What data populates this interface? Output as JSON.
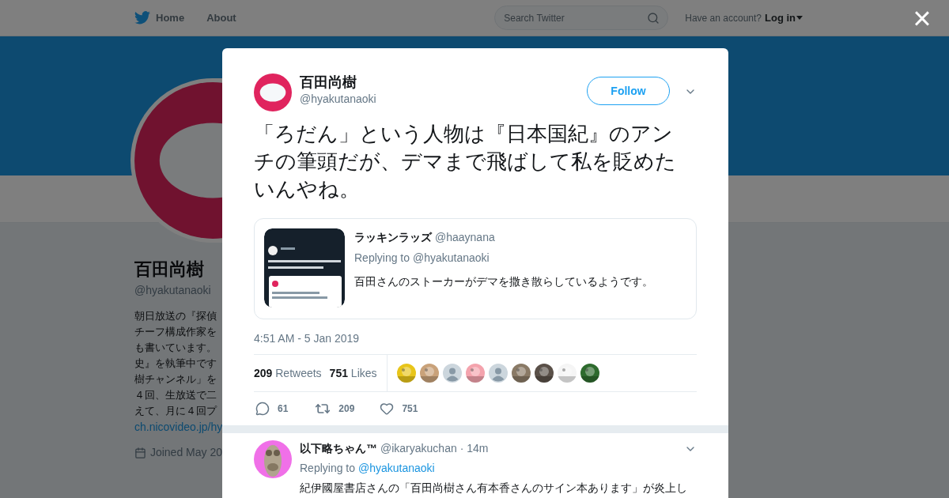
{
  "nav": {
    "home": "Home",
    "about": "About",
    "search_placeholder": "Search Twitter",
    "account_prompt": "Have an account?",
    "login": "Log in"
  },
  "profile": {
    "name": "百田尚樹",
    "handle": "@hyakutanaoki",
    "bio_lines": [
      "朝日放送の『探偵",
      "チーフ構成作家を",
      "も書いています。",
      "史』を執筆中です",
      "樹チャンネル」を",
      "４回、生放送で二",
      "えて、月に４回プ"
    ],
    "link": "ch.nicovideo.jp/hy",
    "joined": "Joined May 20"
  },
  "close": "×",
  "tweet": {
    "name": "百田尚樹",
    "handle": "@hyakutanaoki",
    "follow": "Follow",
    "text": "「ろだん」という人物は『日本国紀』のアンチの筆頭だが、デマまで飛ばして私を貶めたいんやね。",
    "quote": {
      "name": "ラッキンラッズ",
      "handle": "@haaynana",
      "replying_label": "Replying to",
      "replying_to": "@hyakutanaoki",
      "text": "百田さんのストーカーがデマを撒き散らしているようです。",
      "media": {
        "kind": "picture"
      }
    },
    "time": "4:51 AM - 5 Jan 2019",
    "retweets_count": "209",
    "retweets_label": "Retweets",
    "likes_count": "751",
    "likes_label": "Likes",
    "likers": [
      {
        "kind": "picture"
      },
      {
        "kind": "picture"
      },
      {
        "kind": "default"
      },
      {
        "kind": "picture"
      },
      {
        "kind": "default"
      },
      {
        "kind": "picture"
      },
      {
        "kind": "picture"
      },
      {
        "kind": "picture"
      },
      {
        "kind": "picture"
      }
    ],
    "actions": {
      "replies": "61",
      "retweets": "209",
      "likes": "751"
    }
  },
  "reply": {
    "name": "以下略ちゃん™",
    "handle": "@ikaryakuchan",
    "time": "· 14m",
    "replying_label": "Replying to",
    "replying_to": "@hyakutanaoki",
    "text": "紀伊國屋書店さんの「百田尚樹さん有本香さんのサイン本あります」が炎上し"
  }
}
